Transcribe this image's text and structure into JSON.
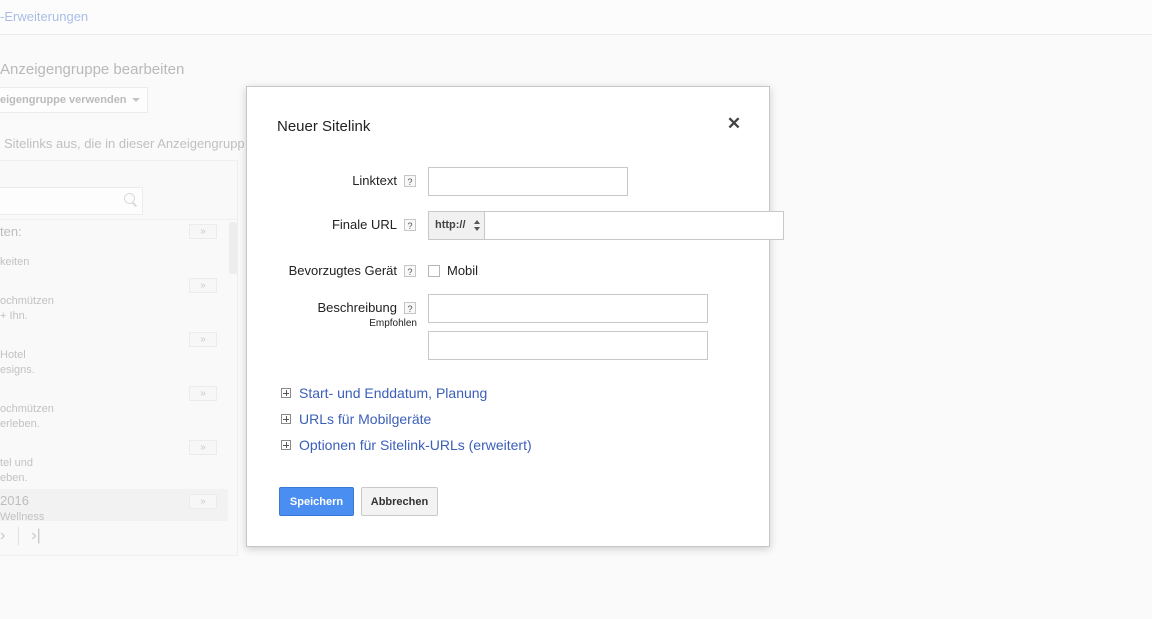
{
  "background": {
    "header_link": "-Erweiterungen",
    "title": "Anzeigengruppe bearbeiten",
    "dropdown_label": "eigengruppe verwenden",
    "description": "Sitelinks aus, die in dieser Anzeigengrupp",
    "list_header": "ten:",
    "items": [
      {
        "line1": "keiten",
        "line2": ""
      },
      {
        "line1": "ochmützen",
        "line2": "+ Ihn."
      },
      {
        "line1": "Hotel",
        "line2": "esigns."
      },
      {
        "line1": "ochmützen",
        "line2": "erleben."
      },
      {
        "line1": "tel und",
        "line2": "eben."
      },
      {
        "line1": "2016",
        "line2": "Wellness"
      }
    ],
    "row_button": "»",
    "pager_next": "›",
    "pager_last": "›|"
  },
  "modal": {
    "title": "Neuer Sitelink",
    "close_symbol": "✕",
    "help_symbol": "?",
    "fields": {
      "linktext_label": "Linktext",
      "linktext_value": "",
      "final_url_label": "Finale URL",
      "protocol_value": "http://",
      "final_url_value": "",
      "device_label": "Bevorzugtes Gerät",
      "device_option": "Mobil",
      "description_label": "Beschreibung",
      "description_hint": "Empfohlen",
      "description_line1": "",
      "description_line2": ""
    },
    "expanders": [
      "Start- und Enddatum, Planung",
      "URLs für Mobilgeräte",
      "Optionen für Sitelink-URLs (erweitert)"
    ],
    "buttons": {
      "save": "Speichern",
      "cancel": "Abbrechen"
    }
  }
}
